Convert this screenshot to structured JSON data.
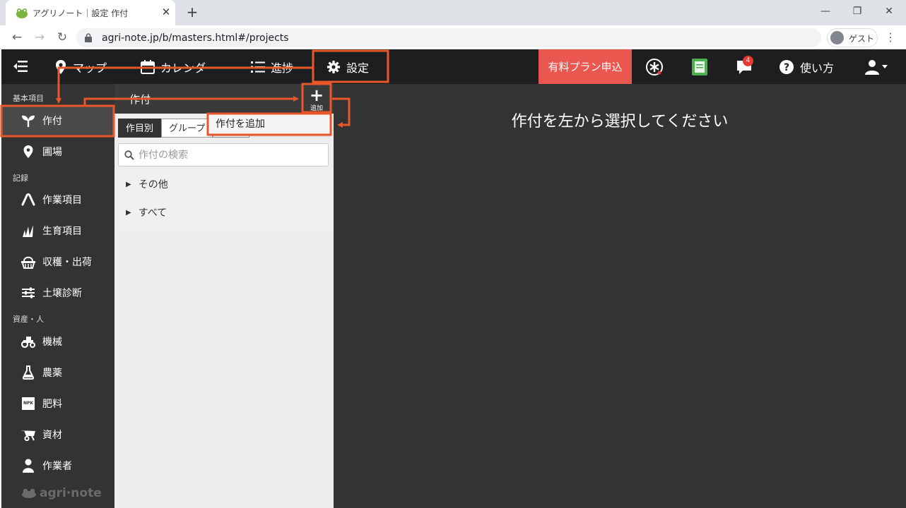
{
  "browser": {
    "tab_title": "アグリノート｜設定 作付",
    "tab_close": "✕",
    "new_tab": "+",
    "url": "agri-note.jp/b/masters.html#/projects",
    "profile_label": "ゲスト",
    "window_controls": [
      "—",
      "❐",
      "✕"
    ]
  },
  "header": {
    "nav": [
      {
        "label": "マップ",
        "icon": "map-pin-icon"
      },
      {
        "label": "カレンダー",
        "icon": "calendar-icon"
      },
      {
        "label": "進捗",
        "icon": "list-icon"
      },
      {
        "label": "設定",
        "icon": "gear-icon"
      }
    ],
    "paid_plan_label": "有料プラン申込",
    "help_label": "使い方",
    "notification_count": "4"
  },
  "sidebar": {
    "sections": [
      {
        "label": "基本項目",
        "items": [
          {
            "label": "作付",
            "icon": "sprout-icon",
            "active": true
          },
          {
            "label": "圃場",
            "icon": "location-pin-icon"
          }
        ]
      },
      {
        "label": "記録",
        "items": [
          {
            "label": "作業項目",
            "icon": "work-icon"
          },
          {
            "label": "生育項目",
            "icon": "grass-icon"
          },
          {
            "label": "収穫・出荷",
            "icon": "basket-icon"
          },
          {
            "label": "土壌診断",
            "icon": "sliders-icon"
          }
        ]
      },
      {
        "label": "資産・人",
        "items": [
          {
            "label": "機械",
            "icon": "tractor-icon"
          },
          {
            "label": "農薬",
            "icon": "flask-icon"
          },
          {
            "label": "肥料",
            "icon": "npk-icon"
          },
          {
            "label": "資材",
            "icon": "wheelbarrow-icon"
          },
          {
            "label": "作業者",
            "icon": "person-icon"
          }
        ]
      }
    ],
    "logo_text": "agri·note",
    "npk_text": "NPK"
  },
  "panel": {
    "title": "作付",
    "add_label": "追加",
    "add_plus": "+",
    "tabs": [
      "作目別",
      "グループ",
      ""
    ],
    "search_placeholder": "作付の検索",
    "tree": [
      "その他",
      "すべて"
    ],
    "tree_marker": "▶",
    "dropdown_item": "作付を追加"
  },
  "main": {
    "message": "作付を左から選択してください"
  },
  "colors": {
    "accent": "#e9574f",
    "annotation": "#e8572a",
    "header_bg": "#1d1e20",
    "sidebar_bg": "#333333"
  }
}
